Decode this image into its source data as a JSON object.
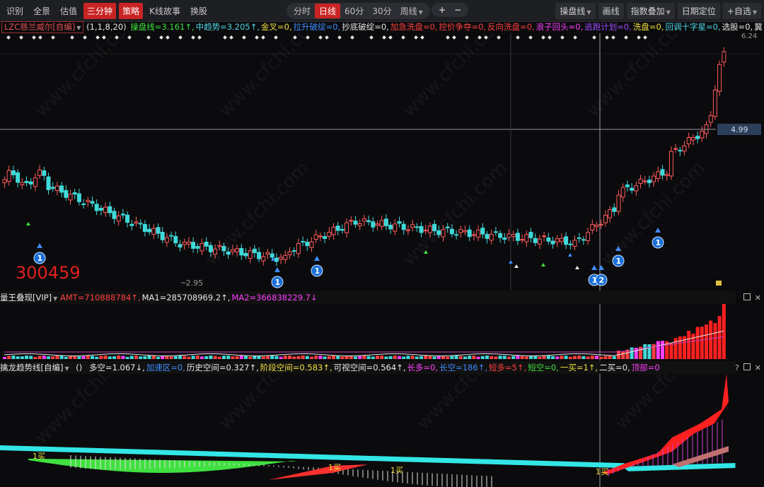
{
  "toolbar": {
    "left_items": [
      "识别",
      "全景",
      "估值",
      "三分钟",
      "策略",
      "K线故事",
      "换股"
    ],
    "periods": [
      "分时",
      "日线",
      "60分",
      "30分",
      "周线"
    ],
    "zoom_in": "+",
    "zoom_out": "−",
    "right_items": [
      "操盘线",
      "画线",
      "指数叠加",
      "日期定位",
      "+自选"
    ]
  },
  "main_panel": {
    "indicator_name": "LZC慈兰威尔[自编]",
    "params": "(1,1,8,20)",
    "values": [
      {
        "text": "操盘线=3.161↑",
        "color": "#3fe03f"
      },
      {
        "text": "中趋势=3.205↑",
        "color": "#4fd7e8"
      },
      {
        "text": "金叉=0",
        "color": "#f0e040"
      },
      {
        "text": "拉升破绽=0",
        "color": "#3f8cff"
      },
      {
        "text": "抄底破绽=0",
        "color": "#e8e8e8"
      },
      {
        "text": "加急洗盘=0",
        "color": "#ff4040"
      },
      {
        "text": "控价争夺=0",
        "color": "#ff4040"
      },
      {
        "text": "反向洗盘=0",
        "color": "#ff4040"
      },
      {
        "text": "浪子回头=0",
        "color": "#ff40ff"
      },
      {
        "text": "逃跑计划=0",
        "color": "#a04cff"
      },
      {
        "text": "洗盘=0",
        "color": "#f0e040"
      },
      {
        "text": "回调十字星=0",
        "color": "#4fd7e8"
      },
      {
        "text": "选股=0",
        "color": "#e8e8e8"
      },
      {
        "text": "冀",
        "color": "#e8e8e8"
      }
    ],
    "stock_code": "300459",
    "price_high": "6.24",
    "price_cursor": "4.99",
    "price_low": "2.95",
    "markers": [
      "1",
      "1",
      "1",
      "1",
      "1",
      "1",
      "2"
    ]
  },
  "volume_panel": {
    "indicator_name": "量王叠现[VIP]",
    "values": [
      {
        "text": "AMT=710888784↑",
        "color": "#ff4040"
      },
      {
        "text": "MA1=285708969.2↑",
        "color": "#e8e8e8"
      },
      {
        "text": "MA2=366838229.7↓",
        "color": "#ff40ff"
      }
    ]
  },
  "trend_panel": {
    "indicator_name": "擒龙趋势线[自编]",
    "params": "()",
    "values": [
      {
        "text": "多空=1.067↓",
        "color": "#e8e8e8"
      },
      {
        "text": "加速区=0",
        "color": "#3f8cff"
      },
      {
        "text": "历史空间=0.327↑",
        "color": "#e8e8e8"
      },
      {
        "text": "阶段空间=0.583↑",
        "color": "#f0e040"
      },
      {
        "text": "可视空间=0.564↑",
        "color": "#e8e8e8"
      },
      {
        "text": "长多=0",
        "color": "#ff40ff"
      },
      {
        "text": "长空=186↑",
        "color": "#3f8cff"
      },
      {
        "text": "短多=5↑",
        "color": "#ff4040"
      },
      {
        "text": "短空=0",
        "color": "#3fe03f"
      },
      {
        "text": "一买=1↑",
        "color": "#f0e040"
      },
      {
        "text": "二买=0",
        "color": "#e8e8e8"
      },
      {
        "text": "顶部=0",
        "color": "#ff40ff"
      }
    ],
    "buy_labels": [
      "1买",
      "1买",
      "1买",
      "1买"
    ],
    "help": "?"
  }
}
